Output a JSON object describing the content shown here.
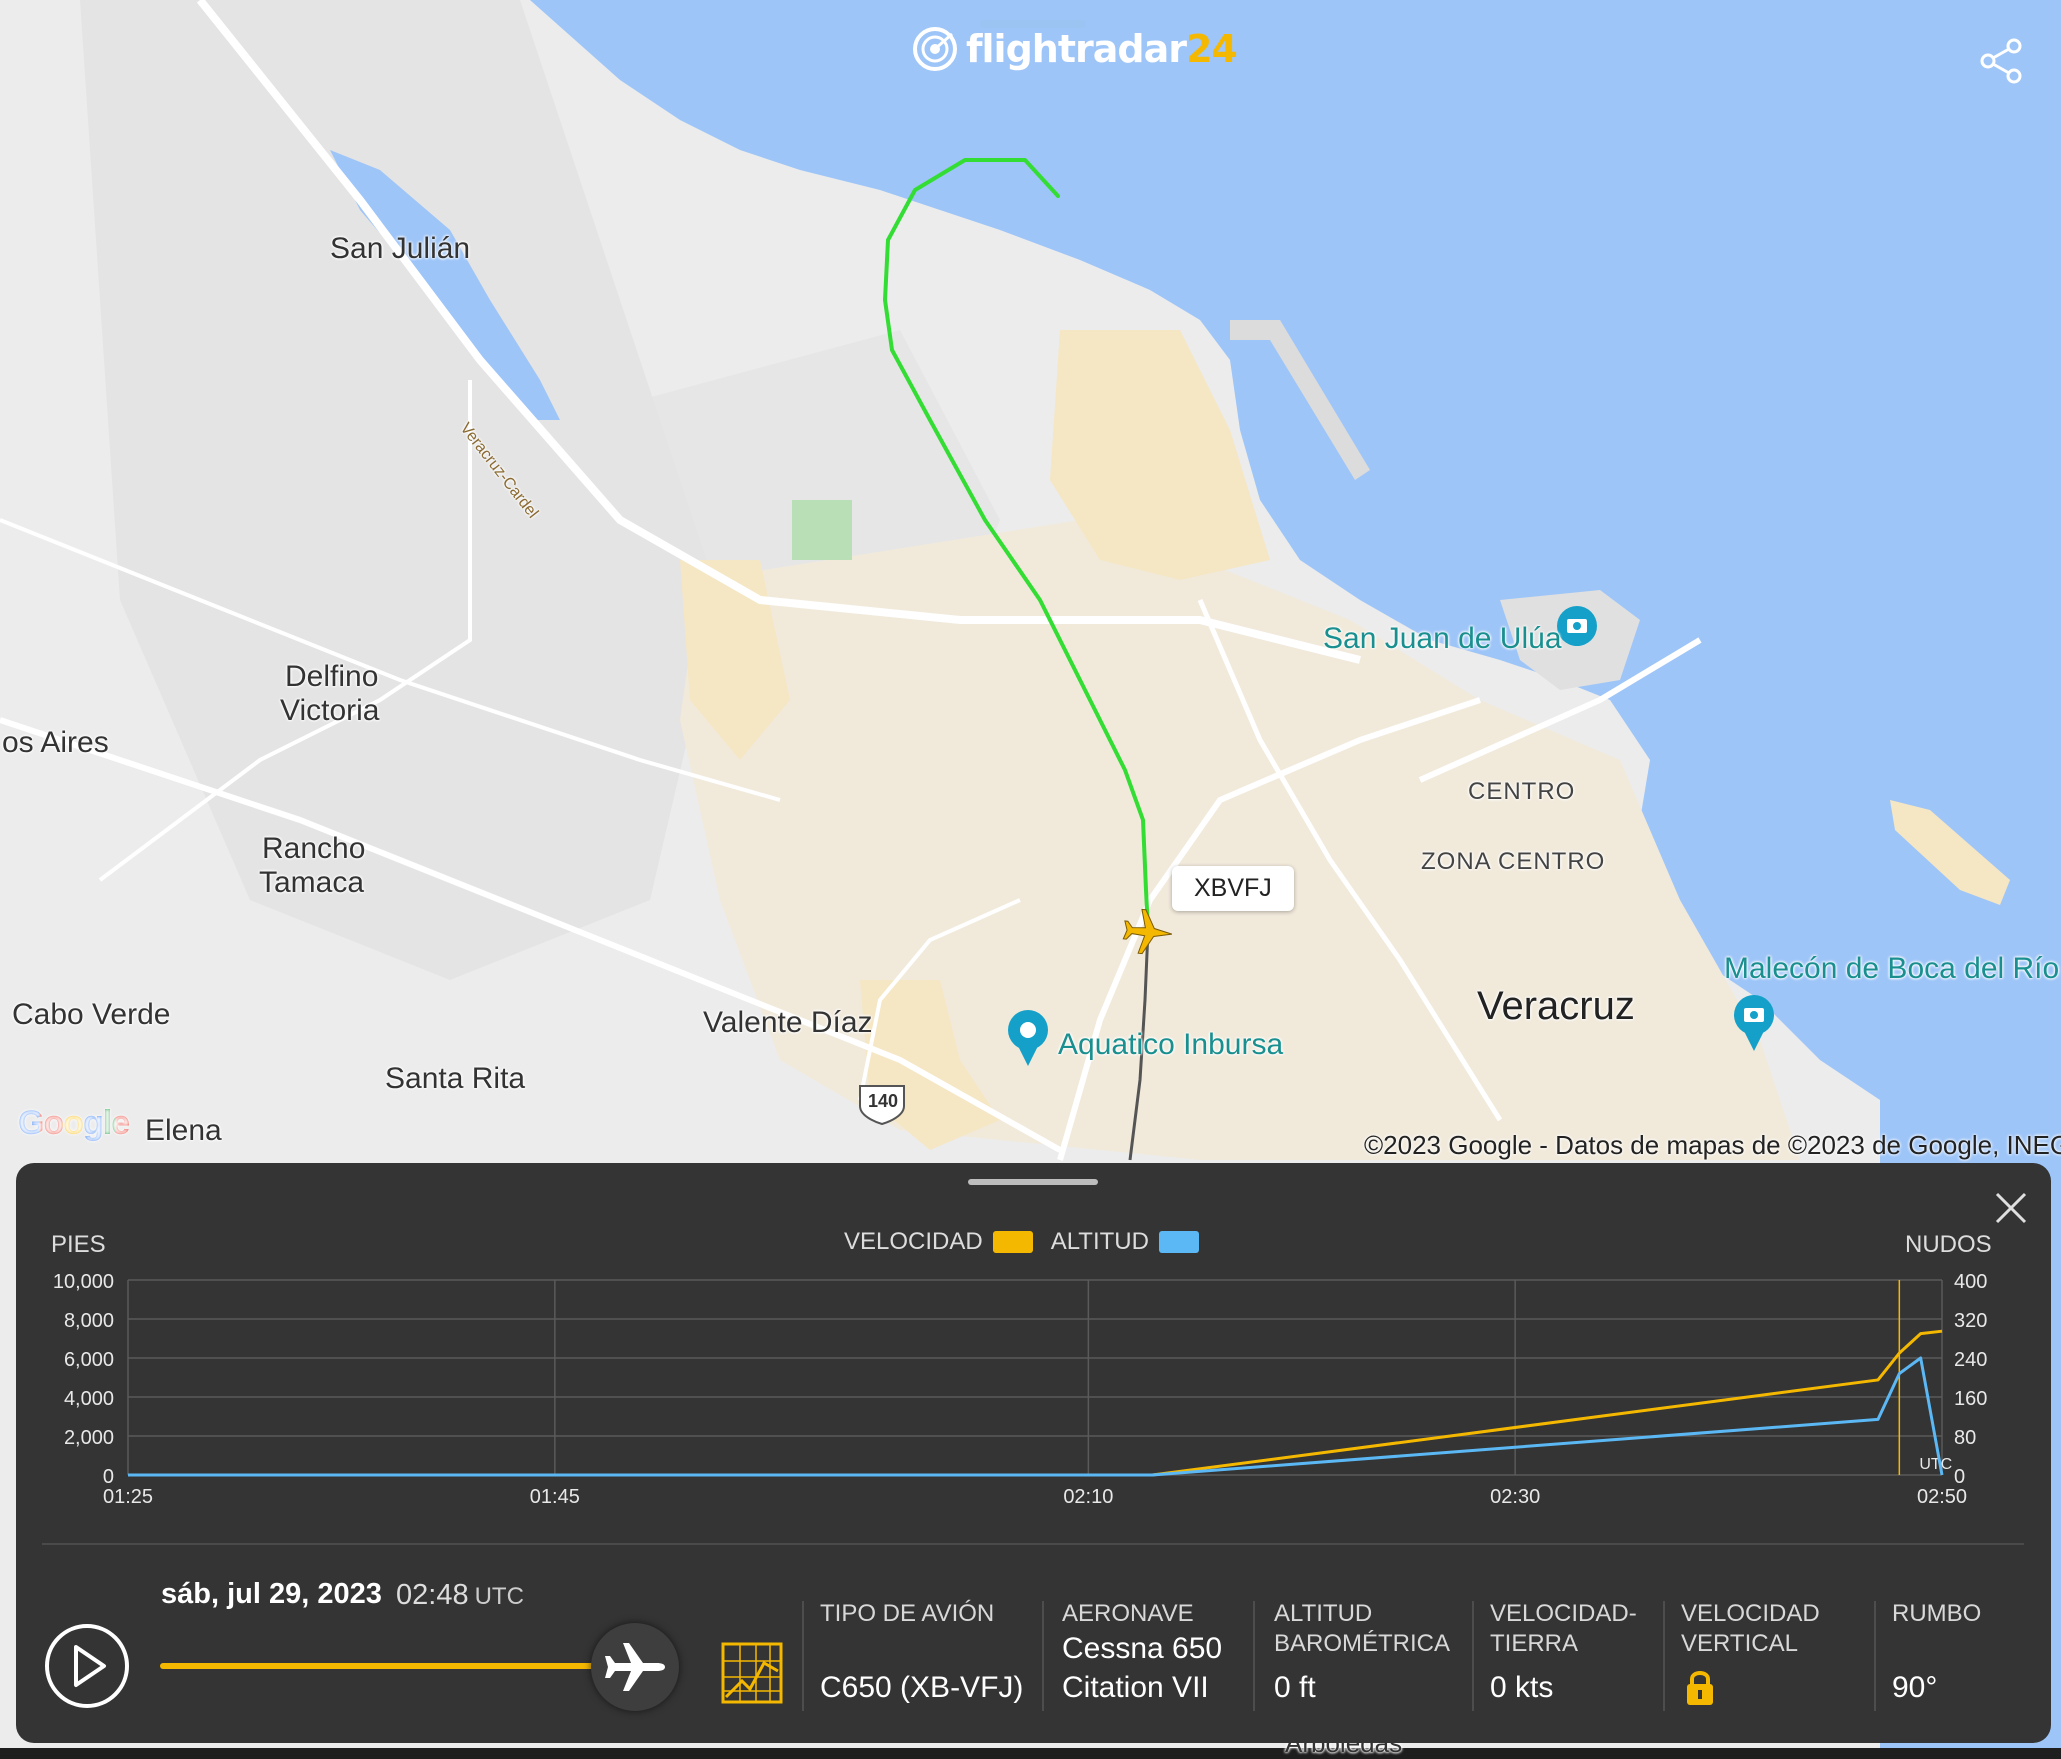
{
  "header": {
    "brand_name": "flightradar",
    "brand_number": "24",
    "share_icon": "share-icon"
  },
  "map": {
    "labels": {
      "san_julian": "San Julián",
      "delfino_victoria_1": "Delfino",
      "delfino_victoria_2": "Victoria",
      "os_aires": "os Aires",
      "rancho_tamaca_1": "Rancho",
      "rancho_tamaca_2": "Tamaca",
      "cabo_verde": "Cabo Verde",
      "valente_diaz": "Valente Díaz",
      "santa_rita": "Santa Rita",
      "elena": "Elena",
      "veracruz_cardel": "Veracruz-Cardel",
      "san_juan_ulua": "San Juan de Ulúa",
      "centro": "CENTRO",
      "zona_centro": "ZONA CENTRO",
      "veracruz": "Veracruz",
      "malecon": "Malecón de Boca del Río",
      "aquatico": "Aquatico Inbursa",
      "route_140": "140",
      "arboledas": "Arboledas"
    },
    "aircraft_callsign": "XBVFJ",
    "attribution": "©2023 Google - Datos de mapas de ©2023 de Google, INEGI",
    "google_logo": "Google",
    "colors": {
      "land": "#ececec",
      "water": "#9ec5f8",
      "urban": "#f5e6c4",
      "track": "#33dd33",
      "aircraft": "#f5b800"
    }
  },
  "panel": {
    "left_axis_title": "PIES",
    "right_axis_title": "NUDOS",
    "legend_speed": "VELOCIDAD",
    "legend_altitude": "ALTITUD",
    "utc_tag": "UTC",
    "date": "sáb, jul 29, 2023",
    "time": "02:48",
    "time_zone": "UTC",
    "playback_progress": 0.97,
    "info": {
      "aircraft_type_label": "TIPO DE AVIÓN",
      "aircraft_type_value": "C650 (XB-VFJ)",
      "aircraft_label": "AERONAVE",
      "aircraft_value_1": "Cessna 650",
      "aircraft_value_2": "Citation VII",
      "baro_alt_label_1": "ALTITUD",
      "baro_alt_label_2": "BAROMÉTRICA",
      "baro_alt_value": "0 ft",
      "ground_speed_label_1": "VELOCIDAD-",
      "ground_speed_label_2": "TIERRA",
      "ground_speed_value": "0 kts",
      "vertical_speed_label_1": "VELOCIDAD",
      "vertical_speed_label_2": "VERTICAL",
      "vertical_speed_icon": "lock-icon",
      "heading_label": "RUMBO",
      "heading_value": "90°"
    },
    "colors": {
      "speed": "#f5b800",
      "altitude": "#5bb8f5"
    }
  },
  "chart_data": {
    "type": "line",
    "x": [
      "01:25",
      "02:10",
      "02:13",
      "02:47",
      "02:48",
      "02:49",
      "02:50"
    ],
    "x_ticks": [
      "01:25",
      "01:45",
      "02:10",
      "02:30",
      "02:50"
    ],
    "series": [
      {
        "name": "VELOCIDAD",
        "axis": "right",
        "values": [
          0,
          0,
          0,
          195,
          250,
          290,
          295
        ]
      },
      {
        "name": "ALTITUD",
        "axis": "left",
        "values": [
          0,
          0,
          0,
          2850,
          5200,
          6000,
          0
        ]
      }
    ],
    "left_axis": {
      "label": "PIES",
      "ticks": [
        "10,000",
        "8,000",
        "6,000",
        "4,000",
        "2,000",
        "0"
      ],
      "ylim": [
        0,
        10000
      ]
    },
    "right_axis": {
      "label": "NUDOS",
      "ticks": [
        "400",
        "320",
        "240",
        "160",
        "80",
        "0"
      ],
      "ylim": [
        0,
        400
      ]
    },
    "cursor_x": "02:48",
    "grid": true,
    "legend_position": "top-center"
  }
}
